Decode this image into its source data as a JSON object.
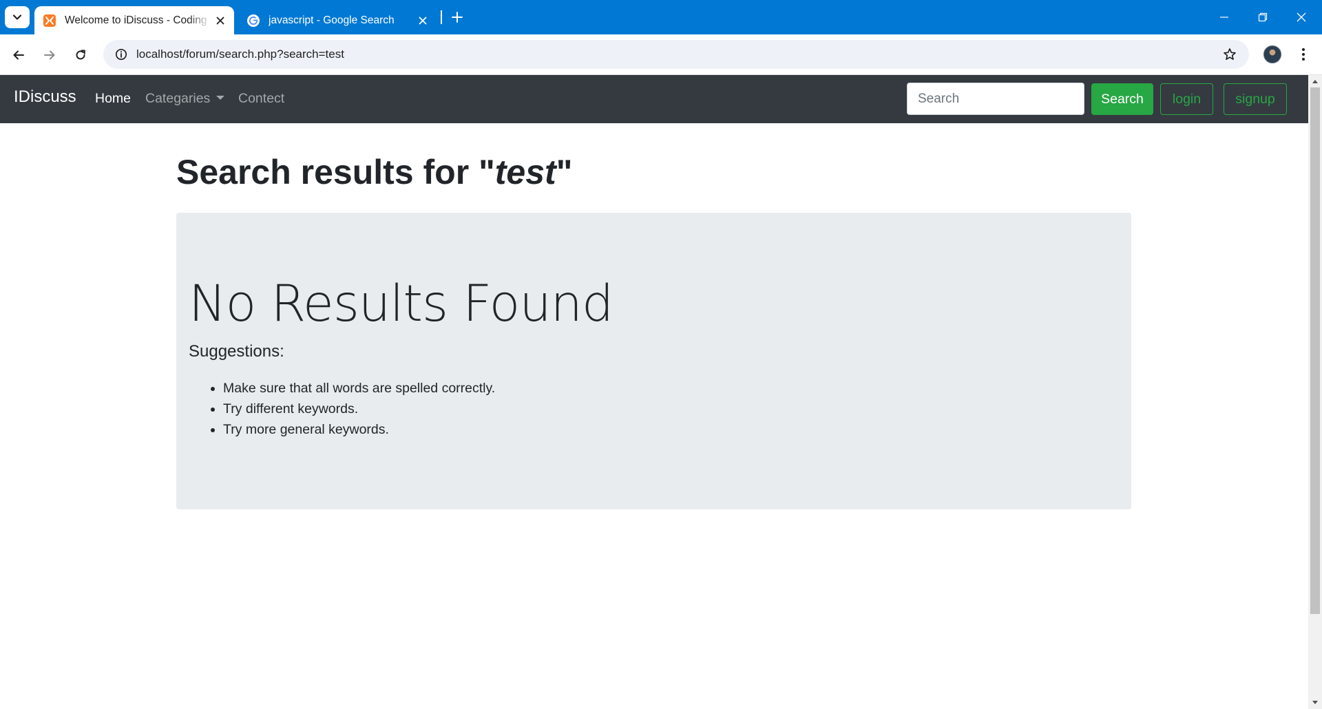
{
  "browser": {
    "tabs": [
      {
        "title": "Welcome to iDiscuss - Coding Forums",
        "active": true,
        "favicon": "xampp-icon"
      },
      {
        "title": "javascript - Google Search",
        "active": false,
        "favicon": "google-icon"
      }
    ],
    "url": "localhost/forum/search.php?search=test"
  },
  "site": {
    "brand": "IDiscuss",
    "nav": {
      "home": "Home",
      "categories": "Categaries",
      "contact": "Contect"
    },
    "search_placeholder": "Search",
    "search_button": "Search",
    "login_button": "login",
    "signup_button": "signup"
  },
  "page": {
    "heading_prefix": "Search results for ",
    "quote_open": "\"",
    "query": "test",
    "quote_close": "\"",
    "no_results_title": "No Results Found",
    "suggestions_label": "Suggestions:",
    "suggestions": [
      "Make sure that all words are spelled correctly.",
      "Try different keywords.",
      "Try more general keywords."
    ]
  },
  "colors": {
    "tabbar": "#0078d4",
    "navbar": "#343a40",
    "success": "#28a745",
    "jumbotron": "#e9ecef"
  }
}
